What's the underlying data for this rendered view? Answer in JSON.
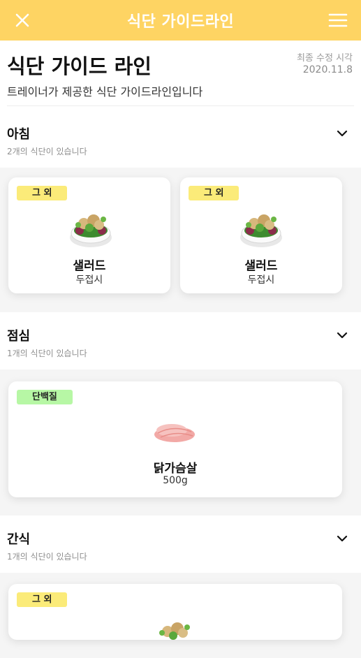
{
  "app_bar": {
    "title": "식단 가이드라인"
  },
  "header": {
    "title": "식단 가이드 라인",
    "subtitle": "트레이너가 제공한 식단 가이드라인입니다",
    "meta_label": "최종 수정 시각",
    "meta_date": "2020.11.8"
  },
  "sections": [
    {
      "title": "아침",
      "count": "2개의 식단이 있습니다",
      "cards": [
        {
          "tag": "그 외",
          "name": "샐러드",
          "amount": "두접시"
        },
        {
          "tag": "그 외",
          "name": "샐러드",
          "amount": "두접시"
        }
      ]
    },
    {
      "title": "점심",
      "count": "1개의 식단이 있습니다",
      "cards": [
        {
          "tag": "단백질",
          "name": "닭가슴살",
          "amount": "500g"
        }
      ]
    },
    {
      "title": "간식",
      "count": "1개의 식단이 있습니다",
      "cards": [
        {
          "tag": "그 외"
        }
      ]
    }
  ],
  "icons": {
    "close": "close-icon",
    "menu": "hamburger-menu-icon",
    "expand": "chevron-down-icon",
    "salad": "salad-bowl-image",
    "chicken": "chicken-breast-image"
  },
  "colors": {
    "app_bar": "#fed463",
    "tag_other": "#fbeb79",
    "tag_protein": "#b7f7a5"
  }
}
